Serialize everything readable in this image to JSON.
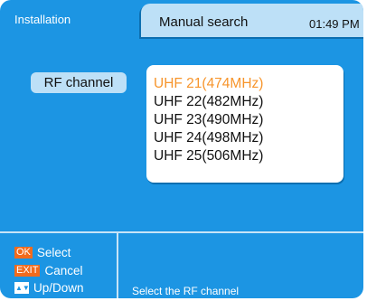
{
  "header": {
    "breadcrumb": "Installation",
    "page_title": "Manual search",
    "clock": "01:49 PM"
  },
  "rf_channel": {
    "label": "RF channel",
    "selected_index": 0,
    "items": [
      {
        "label": "UHF 21(474MHz)"
      },
      {
        "label": "UHF 22(482MHz)"
      },
      {
        "label": "UHF 23(490MHz)"
      },
      {
        "label": "UHF 24(498MHz)"
      },
      {
        "label": "UHF 25(506MHz)"
      }
    ]
  },
  "footer": {
    "keys": [
      {
        "badge": "OK",
        "action": "Select",
        "icon": "ok-key-icon"
      },
      {
        "badge": "EXIT",
        "action": "Cancel",
        "icon": "exit-key-icon"
      },
      {
        "badge": "▲▼",
        "action": "Up/Down",
        "icon": "up-down-arrows-icon"
      }
    ],
    "hint": "Select the RF channel"
  },
  "colors": {
    "background": "#1c95e3",
    "panel": "#bde0f7",
    "highlight": "#f7952c",
    "key_badge": "#f26b1d"
  }
}
